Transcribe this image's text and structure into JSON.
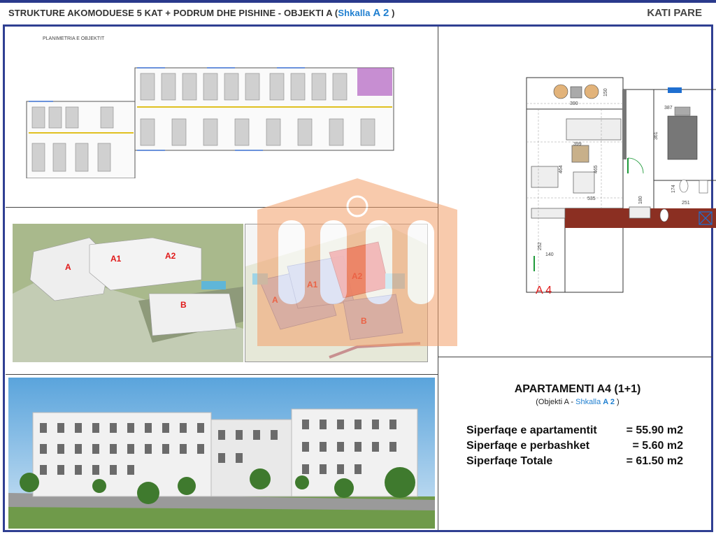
{
  "header": {
    "title_part1": "STRUKTURE AKOMODUESE 5 KAT + PODRUM DHE PISHINE",
    "title_part2": " -  OBJEKTI A (",
    "title_shkalla": "Shkalla ",
    "title_code": "A 2",
    "title_close": " )",
    "floor": "KATI PARE"
  },
  "site_plan": {
    "title": "PLANIMETRIA E OBJEKTIT"
  },
  "render_3d": {
    "labels": [
      "A",
      "A1",
      "A2",
      "B"
    ]
  },
  "site_render": {
    "labels": [
      "A",
      "A1",
      "A2",
      "B"
    ]
  },
  "apartment_plan": {
    "label": "A 4",
    "dims": [
      "390",
      "150",
      "387",
      "361",
      "399",
      "465",
      "535",
      "464",
      "251",
      "140",
      "252",
      "180",
      "174"
    ]
  },
  "info": {
    "title": "APARTAMENTI A4 (1+1)",
    "sub_prefix": "(Objekti A - ",
    "sub_shkalla": "Shkalla ",
    "sub_code": "A 2",
    "sub_suffix": " )",
    "rows": [
      {
        "label": "Siperfaqe e apartamentit",
        "value": "= 55.90 m2"
      },
      {
        "label": "Siperfaqe e perbashket",
        "value": "=  5.60 m2"
      },
      {
        "label": "Siperfaqe Totale",
        "value": "= 61.50 m2"
      }
    ]
  },
  "colors": {
    "frame": "#2f3f92",
    "accent_blue": "#1f7fd0",
    "watermark_orange": "#f4a06a",
    "highlight_red": "#e01818"
  }
}
